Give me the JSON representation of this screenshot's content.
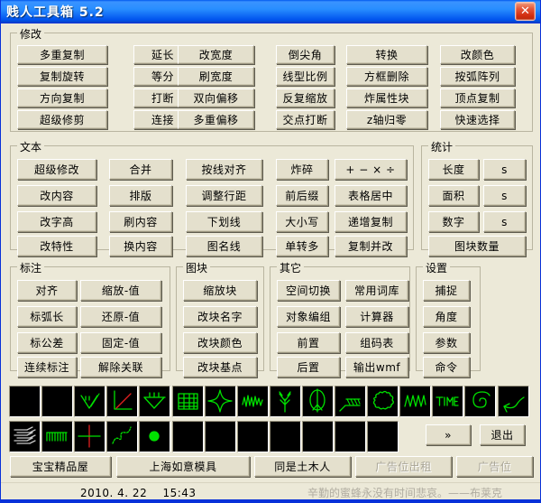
{
  "window": {
    "title": "贱人工具箱 5.2",
    "close_label": "✕"
  },
  "groups": {
    "modify": {
      "title": "修改",
      "columns": [
        [
          "多重复制",
          "复制旋转",
          "方向复制",
          "超级修剪"
        ],
        [
          "延长",
          "等分",
          "打断",
          "连接"
        ],
        [
          "改宽度",
          "刷宽度",
          "双向偏移",
          "多重偏移"
        ],
        [
          "倒尖角",
          "线型比例",
          "反复缩放",
          "交点打断"
        ],
        [
          "转换",
          "方框删除",
          "炸属性块",
          "z轴归零"
        ],
        [
          "改颜色",
          "按弧阵列",
          "顶点复制",
          "快速选择"
        ]
      ]
    },
    "text": {
      "title": "文本",
      "columns": [
        [
          "超级修改",
          "改内容",
          "改字高",
          "改特性"
        ],
        [
          "合并",
          "排版",
          "刷内容",
          "换内容"
        ],
        [
          "按线对齐",
          "调整行距",
          "下划线",
          "图名线"
        ],
        [
          "炸碎",
          "前后缀",
          "大小写",
          "单转多"
        ],
        [
          "+ − × ÷",
          "表格居中",
          "递增复制",
          "复制并改"
        ]
      ]
    },
    "stats": {
      "title": "统计",
      "rows": [
        {
          "main": "长度",
          "side": "s"
        },
        {
          "main": "面积",
          "side": "s"
        },
        {
          "main": "数字",
          "side": "s"
        }
      ],
      "wide": "图块数量"
    },
    "annotation": {
      "title": "标注",
      "columns": [
        [
          "对齐",
          "标弧长",
          "标公差",
          "连续标注"
        ],
        [
          "缩放-值",
          "还原-值",
          "固定-值",
          "解除关联"
        ]
      ]
    },
    "block": {
      "title": "图块",
      "columns": [
        [
          "缩放块",
          "改块名字",
          "改块颜色",
          "改块基点"
        ]
      ]
    },
    "other": {
      "title": "其它",
      "columns": [
        [
          "空间切换",
          "对象编组",
          "前置",
          "后置"
        ],
        [
          "常用词库",
          "计算器",
          "组码表",
          "输出wmf"
        ]
      ]
    },
    "settings": {
      "title": "设置",
      "columns": [
        [
          "捕捉",
          "角度",
          "参数",
          "命令"
        ]
      ]
    }
  },
  "icon_grid": {
    "row1": [
      "blank-icon",
      "blank-icon",
      "elevation-symbol-icon",
      "axis-line-icon",
      "level-marks-icon",
      "table-grid-icon",
      "four-point-star-icon",
      "scribble-wave-icon",
      "tree-branch-icon",
      "antenna-tower-icon",
      "hatch-line-icon",
      "cloud-revision-icon",
      "zigzag-wave-icon",
      "time-text-icon",
      "spiral-icon",
      "arrow-curve-icon"
    ],
    "row2": [
      "hatch-lines-icon",
      "comb-pattern-icon",
      "crosshair-icon",
      "polyline-curve-icon",
      "filled-dot-icon",
      "blank-icon",
      "blank-icon",
      "blank-icon",
      "blank-icon",
      "blank-icon",
      "blank-icon",
      "blank-icon"
    ],
    "more_label": "»",
    "exit_label": "退出"
  },
  "ad_bar": {
    "buttons": [
      {
        "label": "宝宝精品屋",
        "disabled": false
      },
      {
        "label": "上海如意模具",
        "disabled": false
      },
      {
        "label": "同是土木人",
        "disabled": false
      },
      {
        "label": "广告位出租",
        "disabled": true
      },
      {
        "label": "广告位",
        "disabled": true
      }
    ]
  },
  "status": {
    "date": "2010. 4. 22",
    "time": "15:43",
    "quote": "辛勤的蜜蜂永没有时间悲哀。——布莱克"
  },
  "colors": {
    "titlebar_blue": "#0058ee",
    "face": "#ece9d8",
    "icon_green": "#00e000",
    "icon_bg": "#000000",
    "close_red": "#d22e10"
  }
}
